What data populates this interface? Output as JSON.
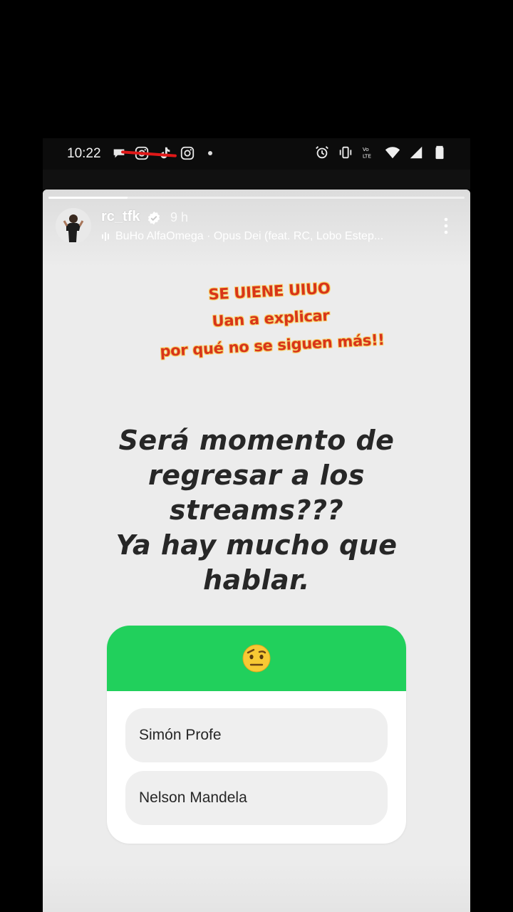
{
  "status_bar": {
    "time": "10:22",
    "left_icons": [
      "chat-bubble-icon",
      "instagram-icon",
      "tiktok-icon",
      "instagram-icon"
    ],
    "right_icons": [
      "alarm-icon",
      "vibrate-icon",
      "volte-icon",
      "wifi-icon",
      "signal-icon",
      "battery-icon"
    ],
    "lte_label": "Vo LTE"
  },
  "story": {
    "username": "rc_tfk",
    "verified": true,
    "time_ago": "9 h",
    "music": "BuHo AlfaOmega · Opus Dei (feat. RC, Lobo Estep...",
    "progress": 0.19,
    "sticker_lines": [
      "SE UIENE UIUO",
      "Uan a explicar",
      "por qué no se siguen más!!"
    ],
    "main_text": [
      "Será momento de",
      "regresar a los",
      "streams???",
      "Ya hay mucho que",
      "hablar."
    ],
    "quiz": {
      "header_color": "#21d05c",
      "emoji": "raised-eyebrow-emoji",
      "options": [
        "Simón Profe",
        "Nelson Mandela"
      ]
    }
  }
}
